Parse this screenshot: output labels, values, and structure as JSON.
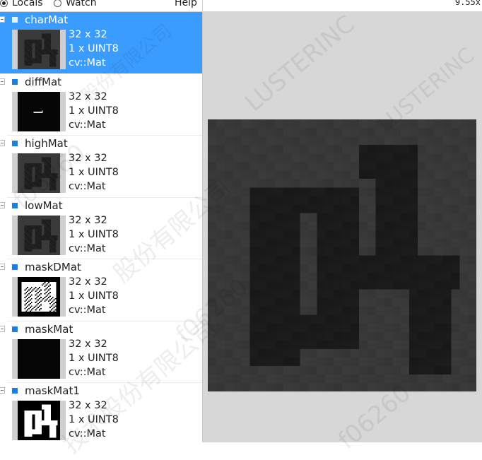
{
  "toolbar": {
    "locals_label": "Locals",
    "watch_label": "Watch",
    "help_label": "Help",
    "zoom_level": "9.55x",
    "selected_tab": "Locals"
  },
  "variables": [
    {
      "name": "charMat",
      "size": "32 x 32",
      "channels": "1 x UINT8",
      "type": "cv::Mat",
      "selected": true,
      "thumb": "dark-glyph"
    },
    {
      "name": "diffMat",
      "size": "32 x 32",
      "channels": "1 x UINT8",
      "type": "cv::Mat",
      "selected": false,
      "thumb": "black-speck"
    },
    {
      "name": "highMat",
      "size": "32 x 32",
      "channels": "1 x UINT8",
      "type": "cv::Mat",
      "selected": false,
      "thumb": "dark-glyph"
    },
    {
      "name": "lowMat",
      "size": "32 x 32",
      "channels": "1 x UINT8",
      "type": "cv::Mat",
      "selected": false,
      "thumb": "dark-glyph"
    },
    {
      "name": "maskDMat",
      "size": "32 x 32",
      "channels": "1 x UINT8",
      "type": "cv::Mat",
      "selected": false,
      "thumb": "white-blob"
    },
    {
      "name": "maskMat",
      "size": "32 x 32",
      "channels": "1 x UINT8",
      "type": "cv::Mat",
      "selected": false,
      "thumb": "black"
    },
    {
      "name": "maskMat1",
      "size": "32 x 32",
      "channels": "1 x UINT8",
      "type": "cv::Mat",
      "selected": false,
      "thumb": "white-glyph"
    }
  ],
  "watermark": {
    "text_lines": [
      "LUSTERINC",
      "f06260",
      "股份有限公司",
      "技术股份有限公司"
    ]
  },
  "colors": {
    "selection": "#3a9cff",
    "marker": "#1b7fe0",
    "viewer_bg": "#d7d7d7",
    "image_dark": "#2f2f2f"
  },
  "viewer": {
    "image_name": "charMat"
  }
}
